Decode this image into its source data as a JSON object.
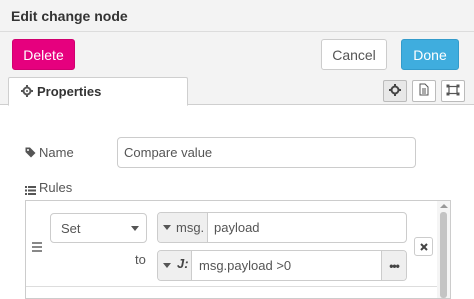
{
  "dialog": {
    "title": "Edit change node"
  },
  "toolbar": {
    "delete_label": "Delete",
    "cancel_label": "Cancel",
    "done_label": "Done"
  },
  "tabs": {
    "properties_label": "Properties"
  },
  "form": {
    "name_label": "Name",
    "name_value": "Compare value",
    "rules_label": "Rules"
  },
  "rule": {
    "action": "Set",
    "target_prefix": "msg.",
    "target_value": "payload",
    "to_label": "to",
    "value_type_icon": "J:",
    "value_expression": "msg.payload >0",
    "expand_label": "•••"
  },
  "colors": {
    "delete": "#e6007e",
    "done": "#3fadde",
    "header_bg": "#f3f3f3"
  },
  "icons": [
    "gear-icon",
    "tag-icon",
    "list-icon",
    "document-icon",
    "frame-icon",
    "close-icon",
    "drag-handle-icon"
  ]
}
